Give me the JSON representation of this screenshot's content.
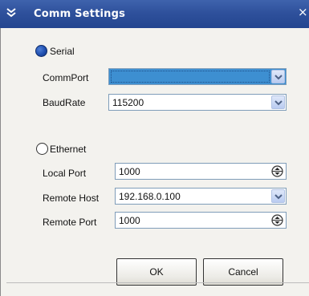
{
  "window": {
    "title": "Comm Settings",
    "close": "×"
  },
  "serial": {
    "radio_label": "Serial",
    "selected": true,
    "comm_port_label": "CommPort",
    "comm_port_value": "",
    "baud_rate_label": "BaudRate",
    "baud_rate_value": "115200"
  },
  "ethernet": {
    "radio_label": "Ethernet",
    "selected": false,
    "local_port_label": "Local Port",
    "local_port_value": "1000",
    "remote_host_label": "Remote Host",
    "remote_host_value": "192.168.0.100",
    "remote_port_label": "Remote Port",
    "remote_port_value": "1000"
  },
  "buttons": {
    "ok": "OK",
    "cancel": "Cancel"
  },
  "colors": {
    "titlebar": "#2f519c",
    "radio_selected": "#1f4fb0",
    "selected_field": "#3d8fd1",
    "dialog_bg": "#f3f2ee"
  }
}
